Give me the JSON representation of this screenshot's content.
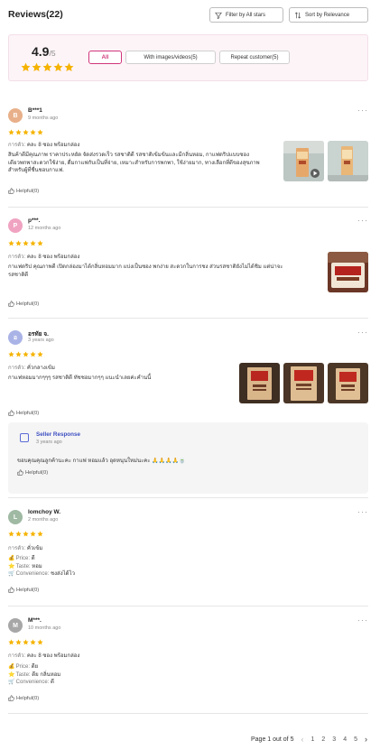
{
  "header": {
    "title": "Reviews(22)",
    "filter_label": "Filter by All stars",
    "sort_label": "Sort by Relevance"
  },
  "summary": {
    "score": "4.9",
    "score_suffix": "/5",
    "rating_stars": 5,
    "chips": [
      {
        "label": "All",
        "active": true
      },
      {
        "label": "With images/videos(5)",
        "active": false
      },
      {
        "label": "Repeat customer(5)",
        "active": false
      }
    ]
  },
  "reviews": [
    {
      "initial": "B",
      "avatar_color": "#e8b08a",
      "name": "B***1",
      "date": "9 months ago",
      "stars": 5,
      "attr_key": "การตัว:",
      "attr_value": "คละ 8 ซอง พร้อมกล่อง",
      "text_lines": [
        "สินค้าดีมีคุณภาพ ราคาประหยัด จัดส่งรวดเร็ว รสชาติดี รสชาติเข้มข้นและมีกลิ่นหอม, กาแฟดริปแบบซอง",
        "เดียวพกพาสะดวกใช้ง่าย, ดื่มกาแฟกับเป็นที่จ่าย, เหมาะสำหรับการพกพา, ใช้ง่ายมาก, ทางเลือกที่ดีของสุขภาพ",
        "สำหรับผู้ที่ชื่นชอบกาแฟ."
      ],
      "helpful": "Helpful(0)"
    },
    {
      "initial": "P",
      "avatar_color": "#f0a3c1",
      "name": "p***.",
      "date": "12 months ago",
      "stars": 5,
      "attr_key": "การตัว:",
      "attr_value": "คละ 8 ซอง พร้อมกล่อง",
      "text_lines": [
        "กาแฟดริป คุณภาพดี เปิดกล่องมาได้กลิ่นหอมมาก แบ่งเป็นซอง พกง่าย สะดวกในการชง ส่วนรสชาติยังไม่ได้ชิม แต่น่าจะ",
        "รสชาติดี"
      ],
      "helpful": "Helpful(0)"
    },
    {
      "initial": "อ",
      "avatar_color": "#a9b3e6",
      "name": "อรทัย จ.",
      "date": "3 years ago",
      "stars": 5,
      "attr_key": "การตัว:",
      "attr_value": "คั่วกลางเข้ม",
      "text_lines": [
        "กาแฟหอมมากๆๆๆ รสชาติดี ทัชชอมากๆๆ แนะนำเลยค่ะคำนนี้"
      ],
      "helpful": "Helpful(0)",
      "seller": {
        "title": "Seller Response",
        "date": "3 years ago",
        "text": "ขอบคุณคุณลูกค้านะคะ กาแฟ หอมแล้ว อุดหนุนใหม่นะคะ 🙏🙏🙏🙏🍵",
        "helpful": "Helpful(0)"
      }
    },
    {
      "initial": "L",
      "avatar_color": "#9fb9a3",
      "name": "lomchoy W.",
      "date": "2 months ago",
      "stars": 5,
      "attr_key": "การตัว:",
      "attr_value": "คั่วเข้ม",
      "kv": [
        {
          "icon": "💰",
          "key": "Price:",
          "value": "ดี"
        },
        {
          "icon": "⭐",
          "key": "Taste:",
          "value": "หอม"
        },
        {
          "icon": "🛒",
          "key": "Convenience:",
          "value": "ชงส่งได้ไว"
        }
      ],
      "helpful": "Helpful(0)"
    },
    {
      "initial": "M",
      "avatar_color": "#a7a7a7",
      "name": "M***.",
      "date": "10 months ago",
      "stars": 5,
      "attr_key": "การตัว:",
      "attr_value": "คละ 8 ซอง พร้อมกล่อง",
      "kv": [
        {
          "icon": "💰",
          "key": "Price:",
          "value": "ดีย"
        },
        {
          "icon": "⭐",
          "key": "Taste:",
          "value": "ดีย กลิ่นหอม"
        },
        {
          "icon": "🛒",
          "key": "Convenience:",
          "value": "ดี"
        }
      ],
      "helpful": "Helpful(0)"
    }
  ],
  "pagination": {
    "label": "Page 1 out of 5",
    "pages": [
      "1",
      "2",
      "3",
      "4",
      "5"
    ]
  },
  "colors": {
    "accent": "#d0357a",
    "star": "#f5b301",
    "seller_blue": "#3d4fc2"
  }
}
